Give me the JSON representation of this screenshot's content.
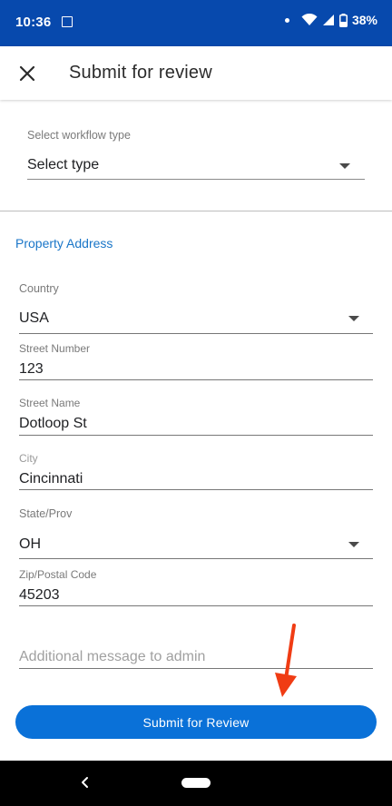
{
  "status_bar": {
    "time": "10:36",
    "battery": "38%"
  },
  "app_bar": {
    "title": "Submit for review"
  },
  "workflow": {
    "label": "Select workflow type",
    "value": "Select type"
  },
  "section": {
    "title": "Property Address"
  },
  "fields": {
    "country": {
      "label": "Country",
      "value": "USA"
    },
    "street_number": {
      "label": "Street Number",
      "value": "123"
    },
    "street_name": {
      "label": "Street Name",
      "value": "Dotloop St"
    },
    "city": {
      "label": "City",
      "value": "Cincinnati"
    },
    "state": {
      "label": "State/Prov",
      "value": "OH"
    },
    "zip": {
      "label": "Zip/Postal Code",
      "value": "45203"
    }
  },
  "message": {
    "placeholder": "Additional message to admin"
  },
  "submit": {
    "label": "Submit for Review"
  },
  "colors": {
    "status_bar": "#0749ad",
    "accent": "#1a76c8",
    "button": "#0a71d8",
    "annotation": "#f03c14"
  }
}
